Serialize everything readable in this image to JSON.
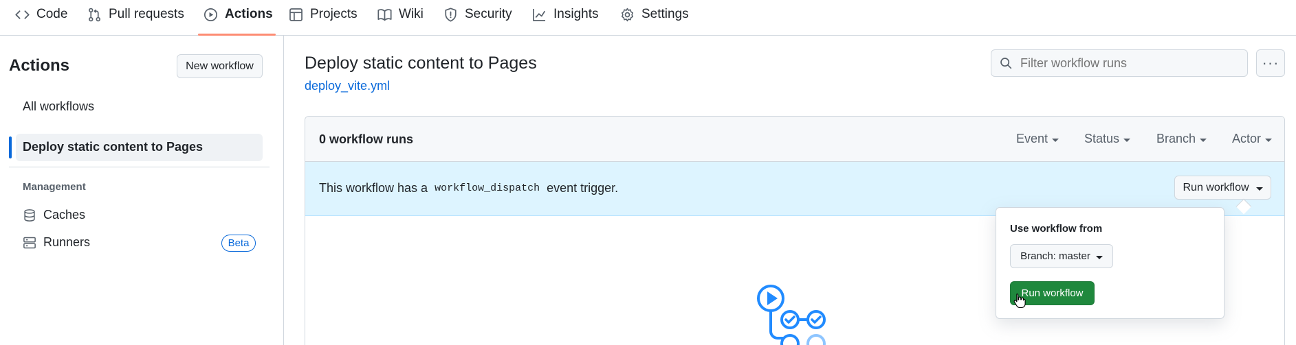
{
  "nav": {
    "tabs": [
      {
        "label": "Code",
        "icon": "code-icon"
      },
      {
        "label": "Pull requests",
        "icon": "git-pull-request-icon"
      },
      {
        "label": "Actions",
        "icon": "play-icon",
        "active": true
      },
      {
        "label": "Projects",
        "icon": "table-icon"
      },
      {
        "label": "Wiki",
        "icon": "book-icon"
      },
      {
        "label": "Security",
        "icon": "shield-icon"
      },
      {
        "label": "Insights",
        "icon": "graph-icon"
      },
      {
        "label": "Settings",
        "icon": "gear-icon"
      }
    ],
    "active_underline_color": "#fd8c73"
  },
  "sidebar": {
    "title": "Actions",
    "new_workflow_label": "New workflow",
    "all_workflows_label": "All workflows",
    "active_workflow_label": "Deploy static content to Pages",
    "management_label": "Management",
    "caches_label": "Caches",
    "runners_label": "Runners",
    "runners_badge": "Beta"
  },
  "main": {
    "title": "Deploy static content to Pages",
    "file_link": "deploy_vite.yml",
    "filter_placeholder": "Filter workflow runs",
    "runs_count": "0 workflow runs",
    "filters": {
      "event": "Event",
      "status": "Status",
      "branch": "Branch",
      "actor": "Actor"
    },
    "banner": {
      "prefix": "This workflow has a",
      "code": "workflow_dispatch",
      "suffix": "event trigger.",
      "run_workflow_label": "Run workflow"
    }
  },
  "popover": {
    "title": "Use workflow from",
    "branch_label": "Branch: master",
    "run_button_label": "Run workflow"
  },
  "colors": {
    "link": "#0969da",
    "banner_bg": "#ddf4ff",
    "primary_green": "#1f883d",
    "illustration_blue": "#218bff"
  }
}
